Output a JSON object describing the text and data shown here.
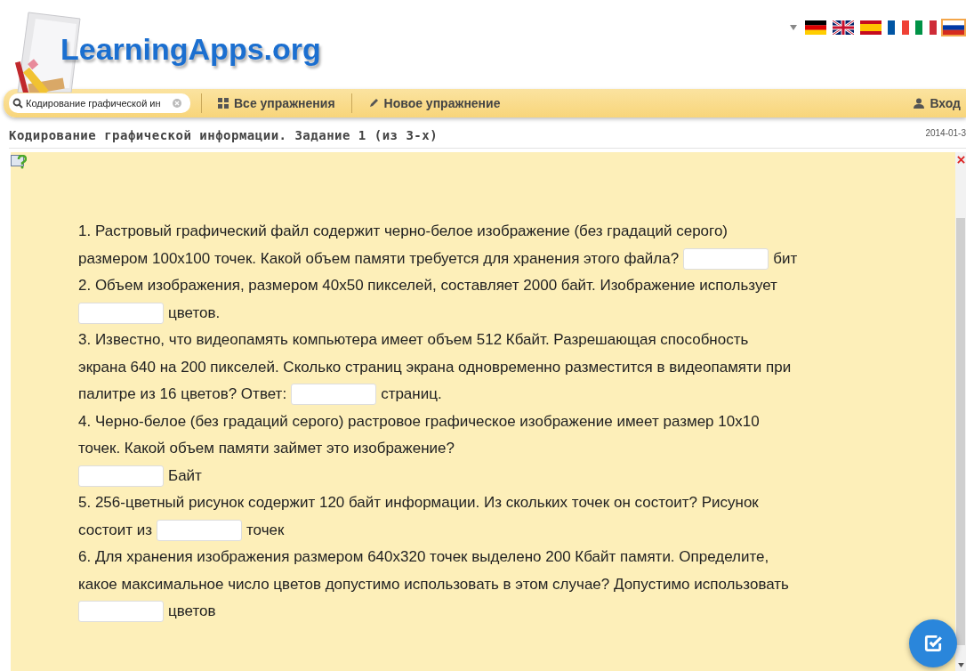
{
  "logo": {
    "text": "LearningApps.org"
  },
  "languages": [
    {
      "kind": "de",
      "selected": false
    },
    {
      "kind": "gb",
      "selected": false
    },
    {
      "kind": "es",
      "selected": false
    },
    {
      "kind": "fr",
      "selected": false
    },
    {
      "kind": "it",
      "selected": false
    },
    {
      "kind": "ru",
      "selected": true
    }
  ],
  "toolbar": {
    "search": {
      "value": "Кодирование графической ин"
    },
    "all_exercises": "Все упражнения",
    "new_exercise": "Новое упражнение",
    "login": "Вход"
  },
  "app": {
    "title": "Кодирование графической информации. Задание 1 (из 3-х)",
    "date": "2014-01-3"
  },
  "questions": [
    [
      [
        {
          "kind": "text",
          "text": "1. Растровый графический файл содержит черно-белое изображение (без градаций серого)"
        }
      ],
      [
        {
          "kind": "text",
          "text": "размером 100x100 точек. Какой объем памяти требуется для хранения этого файла?"
        },
        {
          "kind": "blank"
        },
        {
          "kind": "text",
          "text": "бит"
        }
      ]
    ],
    [
      [
        {
          "kind": "text",
          "text": "2. Объем изображения, размером 40x50 пикселей, составляет 2000 байт. Изображение использует"
        }
      ],
      [
        {
          "kind": "blank"
        },
        {
          "kind": "text",
          "text": "цветов."
        }
      ]
    ],
    [
      [
        {
          "kind": "text",
          "text": "3. Известно, что видеопамять компьютера имеет объем 512 Кбайт. Разрешающая способность"
        }
      ],
      [
        {
          "kind": "text",
          "text": "экрана 640 на 200 пикселей. Сколько страниц экрана одновременно разместится в видеопамяти при"
        }
      ],
      [
        {
          "kind": "text",
          "text": "палитре из 16 цветов? Ответ:"
        },
        {
          "kind": "blank"
        },
        {
          "kind": "text",
          "text": "страниц."
        }
      ]
    ],
    [
      [
        {
          "kind": "text",
          "text": "4. Черно-белое (без градаций серого) растровое графическое изображение имеет размер 10x10"
        }
      ],
      [
        {
          "kind": "text",
          "text": "точек. Какой объем памяти займет это изображение?"
        }
      ],
      [
        {
          "kind": "blank"
        },
        {
          "kind": "text",
          "text": "Байт"
        }
      ]
    ],
    [
      [
        {
          "kind": "text",
          "text": "5. 256-цветный рисунок содержит 120 байт информации. Из скольких точек он состоит? Рисунок"
        }
      ],
      [
        {
          "kind": "text",
          "text": "состоит из"
        },
        {
          "kind": "blank"
        },
        {
          "kind": "text",
          "text": "точек"
        }
      ]
    ],
    [
      [
        {
          "kind": "text",
          "text": "6. Для хранения изображения размером 640x320 точек выделено 200 Кбайт памяти. Определите,"
        }
      ],
      [
        {
          "kind": "text",
          "text": "какое максимальное число цветов допустимо использовать в этом случае? Допустимо использовать"
        }
      ],
      [
        {
          "kind": "blank"
        },
        {
          "kind": "text",
          "text": "цветов"
        }
      ]
    ]
  ]
}
